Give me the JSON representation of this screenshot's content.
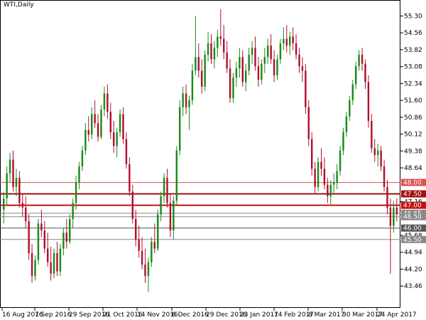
{
  "header": {
    "symbol_title": "WTI,Daily"
  },
  "chart_data": {
    "type": "candlestick",
    "title": "WTI,Daily",
    "ylim": [
      42.5,
      56.0
    ],
    "y_ticks": [
      {
        "value": 55.3,
        "label": "55.30"
      },
      {
        "value": 54.56,
        "label": "54.56"
      },
      {
        "value": 53.82,
        "label": "53.82"
      },
      {
        "value": 53.08,
        "label": "53.08"
      },
      {
        "value": 52.34,
        "label": "52.34"
      },
      {
        "value": 51.6,
        "label": "51.60"
      },
      {
        "value": 50.86,
        "label": "50.86"
      },
      {
        "value": 50.12,
        "label": "50.12"
      },
      {
        "value": 49.38,
        "label": "49.38"
      },
      {
        "value": 48.64,
        "label": "48.64"
      },
      {
        "value": 47.16,
        "label": "47.16"
      },
      {
        "value": 45.68,
        "label": "45.68"
      },
      {
        "value": 44.94,
        "label": "44.94"
      },
      {
        "value": 44.2,
        "label": "44.20"
      },
      {
        "value": 43.46,
        "label": "43.46"
      }
    ],
    "x_labels": [
      "16 Aug 2016",
      "7 Sep 2016",
      "29 Sep 2016",
      "21 Oct 2016",
      "14 Nov 2016",
      "6 Dec 2016",
      "29 Dec 2016",
      "23 Jan 2017",
      "14 Feb 2017",
      "8 Mar 2017",
      "30 Mar 2017",
      "24 Apr 2017"
    ],
    "levels": [
      {
        "value": 48.0,
        "label": "48.00",
        "color": "#e05050",
        "width": 1
      },
      {
        "value": 47.5,
        "label": "47.50",
        "color": "#a01010",
        "width": 2
      },
      {
        "value": 47.0,
        "label": "47.00",
        "color": "#c01010",
        "width": 2
      },
      {
        "value": 46.65,
        "label": "46.65",
        "color": "#888888",
        "width": 1
      },
      {
        "value": 46.5,
        "label": "46.50",
        "color": "#888888",
        "width": 1
      },
      {
        "value": 46.0,
        "label": "46.00",
        "color": "#555555",
        "width": 1
      },
      {
        "value": 45.5,
        "label": "45.50",
        "color": "#888888",
        "width": 1
      }
    ],
    "up_color": "#1a8a1a",
    "down_color": "#b01030",
    "ohlc": [
      [
        46.8,
        47.6,
        46.2,
        47.3
      ],
      [
        47.3,
        48.7,
        47.0,
        48.4
      ],
      [
        48.4,
        49.3,
        48.0,
        49.0
      ],
      [
        49.0,
        49.4,
        47.6,
        47.8
      ],
      [
        47.8,
        48.6,
        47.4,
        48.2
      ],
      [
        48.2,
        48.5,
        46.9,
        47.1
      ],
      [
        47.1,
        47.5,
        46.5,
        46.9
      ],
      [
        46.9,
        47.4,
        46.0,
        46.3
      ],
      [
        46.3,
        46.6,
        44.6,
        44.9
      ],
      [
        44.9,
        45.3,
        43.6,
        43.9
      ],
      [
        43.9,
        44.8,
        43.7,
        44.6
      ],
      [
        44.6,
        46.4,
        44.4,
        46.2
      ],
      [
        46.2,
        46.8,
        45.6,
        45.9
      ],
      [
        45.9,
        46.3,
        44.9,
        45.1
      ],
      [
        45.1,
        45.8,
        44.3,
        44.5
      ],
      [
        44.5,
        45.2,
        43.7,
        44.0
      ],
      [
        44.0,
        45.1,
        43.8,
        44.9
      ],
      [
        44.9,
        45.4,
        43.9,
        44.1
      ],
      [
        44.1,
        45.3,
        43.9,
        45.1
      ],
      [
        45.1,
        46.0,
        44.8,
        45.8
      ],
      [
        45.8,
        46.4,
        45.1,
        45.4
      ],
      [
        45.4,
        46.6,
        45.3,
        46.4
      ],
      [
        46.4,
        47.3,
        46.0,
        47.1
      ],
      [
        47.1,
        48.3,
        46.8,
        48.0
      ],
      [
        48.0,
        48.9,
        47.7,
        48.7
      ],
      [
        48.7,
        49.6,
        48.5,
        49.4
      ],
      [
        49.4,
        50.6,
        49.2,
        50.3
      ],
      [
        50.3,
        50.9,
        49.8,
        50.1
      ],
      [
        50.1,
        51.3,
        49.9,
        51.0
      ],
      [
        51.0,
        51.6,
        50.4,
        50.6
      ],
      [
        50.6,
        51.0,
        49.8,
        50.0
      ],
      [
        50.0,
        51.4,
        49.9,
        51.2
      ],
      [
        51.2,
        52.2,
        50.9,
        51.9
      ],
      [
        51.9,
        52.3,
        50.8,
        51.1
      ],
      [
        51.1,
        51.5,
        49.9,
        50.2
      ],
      [
        50.2,
        50.7,
        49.3,
        49.6
      ],
      [
        49.6,
        50.4,
        49.1,
        50.2
      ],
      [
        50.2,
        51.2,
        50.0,
        51.0
      ],
      [
        51.0,
        51.3,
        49.7,
        49.9
      ],
      [
        49.9,
        50.2,
        48.6,
        48.8
      ],
      [
        48.8,
        49.1,
        47.4,
        47.6
      ],
      [
        47.6,
        47.9,
        46.2,
        46.4
      ],
      [
        46.4,
        46.8,
        45.2,
        45.5
      ],
      [
        45.5,
        46.1,
        44.7,
        45.0
      ],
      [
        45.0,
        45.6,
        44.2,
        44.4
      ],
      [
        44.4,
        45.1,
        43.6,
        43.9
      ],
      [
        43.9,
        44.7,
        43.2,
        44.5
      ],
      [
        44.5,
        45.6,
        44.3,
        45.4
      ],
      [
        45.4,
        46.2,
        44.9,
        45.1
      ],
      [
        45.1,
        46.8,
        45.0,
        46.6
      ],
      [
        46.6,
        47.6,
        46.3,
        47.4
      ],
      [
        47.4,
        48.4,
        47.1,
        48.2
      ],
      [
        48.2,
        48.6,
        46.9,
        47.1
      ],
      [
        47.1,
        47.5,
        45.6,
        45.9
      ],
      [
        45.9,
        47.4,
        45.5,
        47.2
      ],
      [
        47.2,
        49.6,
        47.0,
        49.4
      ],
      [
        49.4,
        51.6,
        49.2,
        51.3
      ],
      [
        51.3,
        52.2,
        50.9,
        51.9
      ],
      [
        51.9,
        52.3,
        51.0,
        51.3
      ],
      [
        51.3,
        51.8,
        50.3,
        51.6
      ],
      [
        51.6,
        53.2,
        51.4,
        52.9
      ],
      [
        52.9,
        55.3,
        52.7,
        53.5
      ],
      [
        53.5,
        54.1,
        52.6,
        52.9
      ],
      [
        52.9,
        53.4,
        51.9,
        52.2
      ],
      [
        52.2,
        53.8,
        52.0,
        53.6
      ],
      [
        53.6,
        54.6,
        53.3,
        54.1
      ],
      [
        54.1,
        54.5,
        53.2,
        53.4
      ],
      [
        53.4,
        54.2,
        53.0,
        53.9
      ],
      [
        53.9,
        54.7,
        53.5,
        54.4
      ],
      [
        54.4,
        55.6,
        54.0,
        54.3
      ],
      [
        54.3,
        54.9,
        53.4,
        53.7
      ],
      [
        53.7,
        54.2,
        52.8,
        53.0
      ],
      [
        53.0,
        53.4,
        51.5,
        51.7
      ],
      [
        51.7,
        52.8,
        51.5,
        52.6
      ],
      [
        52.6,
        53.3,
        52.2,
        53.0
      ],
      [
        53.0,
        53.9,
        52.6,
        53.5
      ],
      [
        53.5,
        53.8,
        52.2,
        52.4
      ],
      [
        52.4,
        53.2,
        52.0,
        52.9
      ],
      [
        52.9,
        53.9,
        52.7,
        53.6
      ],
      [
        53.6,
        54.2,
        53.2,
        53.9
      ],
      [
        53.9,
        54.4,
        52.9,
        53.1
      ],
      [
        53.1,
        53.5,
        52.2,
        52.5
      ],
      [
        52.5,
        53.4,
        52.3,
        53.2
      ],
      [
        53.2,
        53.9,
        52.8,
        53.5
      ],
      [
        53.5,
        54.3,
        53.2,
        54.0
      ],
      [
        54.0,
        54.5,
        53.2,
        53.4
      ],
      [
        53.4,
        53.8,
        52.4,
        52.7
      ],
      [
        52.7,
        53.6,
        52.5,
        53.4
      ],
      [
        53.4,
        54.3,
        53.2,
        54.1
      ],
      [
        54.1,
        54.8,
        53.8,
        54.3
      ],
      [
        54.3,
        54.9,
        53.7,
        54.0
      ],
      [
        54.0,
        54.6,
        53.6,
        54.4
      ],
      [
        54.4,
        54.8,
        53.8,
        54.1
      ],
      [
        54.1,
        54.5,
        53.4,
        53.6
      ],
      [
        53.6,
        53.9,
        52.8,
        53.1
      ],
      [
        53.1,
        53.5,
        52.4,
        52.9
      ],
      [
        52.9,
        53.2,
        51.0,
        51.3
      ],
      [
        51.3,
        51.6,
        49.6,
        49.9
      ],
      [
        49.9,
        50.2,
        48.3,
        48.6
      ],
      [
        48.6,
        48.9,
        47.5,
        47.8
      ],
      [
        47.8,
        49.1,
        47.6,
        48.9
      ],
      [
        48.9,
        49.5,
        48.3,
        48.6
      ],
      [
        48.6,
        49.1,
        47.7,
        47.9
      ],
      [
        47.9,
        48.2,
        47.1,
        47.4
      ],
      [
        47.4,
        48.1,
        47.0,
        47.9
      ],
      [
        47.9,
        48.4,
        47.5,
        48.0
      ],
      [
        48.0,
        48.8,
        47.7,
        48.5
      ],
      [
        48.5,
        49.6,
        48.3,
        49.4
      ],
      [
        49.4,
        50.4,
        49.2,
        50.2
      ],
      [
        50.2,
        51.1,
        50.0,
        50.9
      ],
      [
        50.9,
        51.8,
        50.7,
        51.6
      ],
      [
        51.6,
        52.5,
        51.4,
        52.3
      ],
      [
        52.3,
        53.3,
        52.1,
        53.1
      ],
      [
        53.1,
        53.8,
        52.9,
        53.6
      ],
      [
        53.6,
        53.9,
        52.9,
        53.2
      ],
      [
        53.2,
        53.4,
        52.1,
        52.4
      ],
      [
        52.4,
        52.7,
        50.4,
        50.7
      ],
      [
        50.7,
        51.0,
        49.3,
        49.5
      ],
      [
        49.5,
        49.9,
        48.9,
        49.2
      ],
      [
        49.2,
        49.7,
        48.7,
        49.4
      ],
      [
        49.4,
        49.6,
        48.5,
        48.7
      ],
      [
        48.7,
        49.0,
        47.6,
        47.8
      ],
      [
        47.8,
        48.1,
        46.6,
        46.9
      ],
      [
        46.9,
        47.3,
        44.0,
        46.1
      ],
      [
        46.1,
        47.2,
        45.8,
        46.9
      ],
      [
        46.9,
        47.3,
        46.3,
        46.6
      ]
    ]
  }
}
